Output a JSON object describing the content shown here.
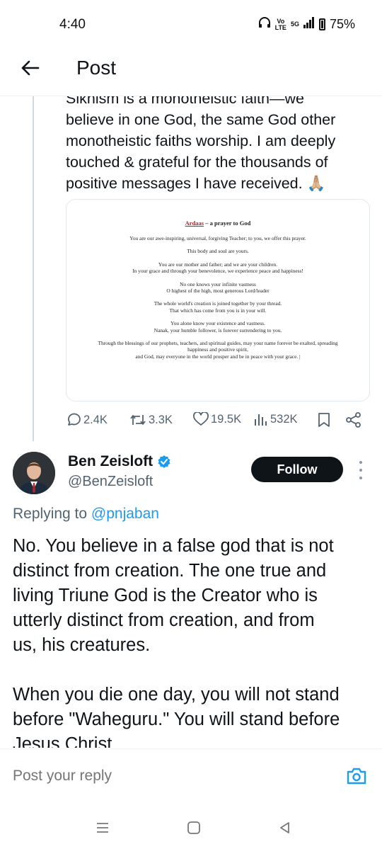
{
  "status_bar": {
    "time": "4:40",
    "vo_label": "Vo",
    "lte_label": "LTE",
    "network": "5G",
    "battery": "75%",
    "icons": [
      "headphones-icon",
      "signal-icon",
      "battery-icon"
    ]
  },
  "header": {
    "title": "Post",
    "back_icon": "arrow-left-icon"
  },
  "original_post": {
    "text_lines": [
      "Sikhism is a monotheistic faith—we",
      "believe in one God, the same God other",
      "monotheistic faiths worship. I am deeply",
      "touched & grateful for the thousands of",
      "positive messages I have received. 🙏🏼"
    ],
    "image_doc": {
      "title": "Ardaas",
      "title_rest": " – a prayer to God",
      "paragraphs": [
        [
          "You are our awe-inspiring, universal, forgiving Teacher; to you, we offer this prayer."
        ],
        [
          "This body and soul are yours."
        ],
        [
          "You are our mother and father; and we are your children.",
          "In your grace and through your benevolence, we experience peace and happiness!"
        ],
        [
          "No one knows your infinite vastness",
          "O highest of the high, most generous Lord/leader"
        ],
        [
          "The whole world's creation is joined together by your thread.",
          "That which has come from you is in your will."
        ],
        [
          "You alone know your existence and vastness.",
          "Nanak, your humble follower, is forever surrendering to you."
        ],
        [
          "Through the blessings of our prophets, teachers, and spiritual guides, may your name forever be exalted, spreading",
          "happiness and positive spirit,",
          "and God, may everyone in the world prosper and be in peace with your grace. |"
        ]
      ]
    },
    "stats": {
      "replies": "2.4K",
      "reposts": "3.3K",
      "likes": "19.5K",
      "views": "532K"
    }
  },
  "reply_post": {
    "display_name": "Ben Zeisloft",
    "handle": "@BenZeisloft",
    "verified": true,
    "follow_label": "Follow",
    "replying_prefix": "Replying to ",
    "replying_to": "@pnjaban",
    "body_lines": [
      "No. You believe in a false god that is not",
      "distinct from creation. The one true and",
      "living Triune God is the Creator who is",
      "utterly distinct from creation, and from",
      "us, his creatures.",
      "",
      "When you die one day, you will not stand",
      "before \"Waheguru.\" You will stand before",
      "Jesus Christ."
    ]
  },
  "composer": {
    "placeholder": "Post your reply",
    "camera_icon": "camera-icon"
  },
  "colors": {
    "accent": "#1d9bf0",
    "text": "#0f1419",
    "secondary": "#536471",
    "follow_bg": "#0f1419"
  }
}
